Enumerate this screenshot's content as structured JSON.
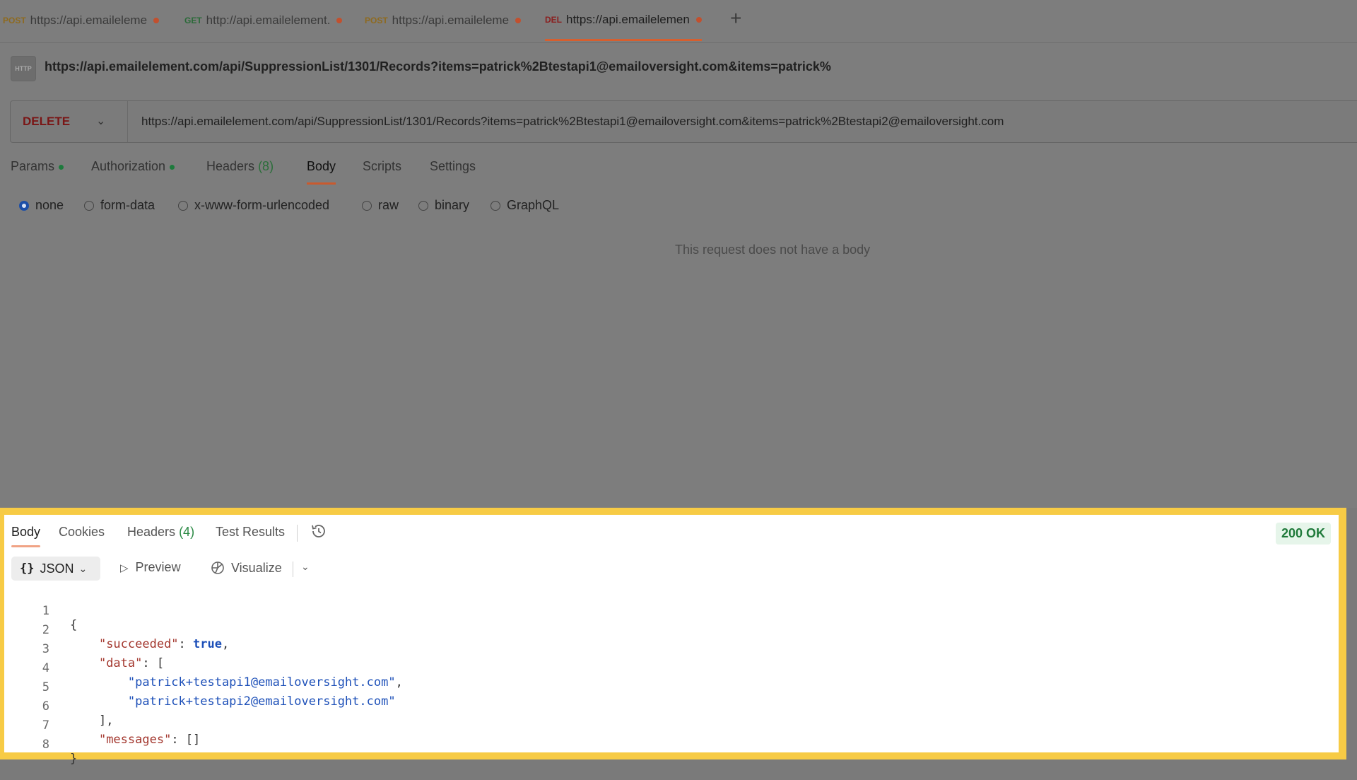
{
  "tabs": [
    {
      "method": "POST",
      "url": "https://api.emaileleme"
    },
    {
      "method": "GET",
      "url": "http://api.emailelement."
    },
    {
      "method": "POST",
      "url": "https://api.emaileleme"
    },
    {
      "method": "DEL",
      "url": "https://api.emailelemen"
    }
  ],
  "add_tab": "+",
  "request": {
    "http_badge": "HTTP",
    "title": "https://api.emailelement.com/api/SuppressionList/1301/Records?items=patrick%2Btestapi1@emailoversight.com&items=patrick%",
    "method": "DELETE",
    "url": "https://api.emailelement.com/api/SuppressionList/1301/Records?items=patrick%2Btestapi1@emailoversight.com&items=patrick%2Btestapi2@emailoversight.com",
    "tabs": {
      "params": "Params",
      "authorization": "Authorization",
      "headers": "Headers",
      "headers_count": "(8)",
      "body": "Body",
      "scripts": "Scripts",
      "settings": "Settings"
    },
    "body_types": [
      "none",
      "form-data",
      "x-www-form-urlencoded",
      "raw",
      "binary",
      "GraphQL"
    ],
    "selected_body_type": "none",
    "no_body_message": "This request does not have a body"
  },
  "response": {
    "tabs": {
      "body": "Body",
      "cookies": "Cookies",
      "headers": "Headers",
      "headers_count": "(4)",
      "test_results": "Test Results"
    },
    "status": "200 OK",
    "format": {
      "braces": "{}",
      "label": "JSON"
    },
    "preview": "Preview",
    "visualize": "Visualize",
    "line_numbers": [
      "1",
      "2",
      "3",
      "4",
      "5",
      "6",
      "7",
      "8"
    ],
    "json": {
      "open": "{",
      "succeeded_key": "\"succeeded\"",
      "succeeded_val": "true",
      "data_key": "\"data\"",
      "data_open": "[",
      "item1": "\"patrick+testapi1@emailoversight.com\"",
      "item2": "\"patrick+testapi2@emailoversight.com\"",
      "data_close": "],",
      "messages_key": "\"messages\"",
      "messages_val": "[]",
      "close": "}"
    }
  }
}
